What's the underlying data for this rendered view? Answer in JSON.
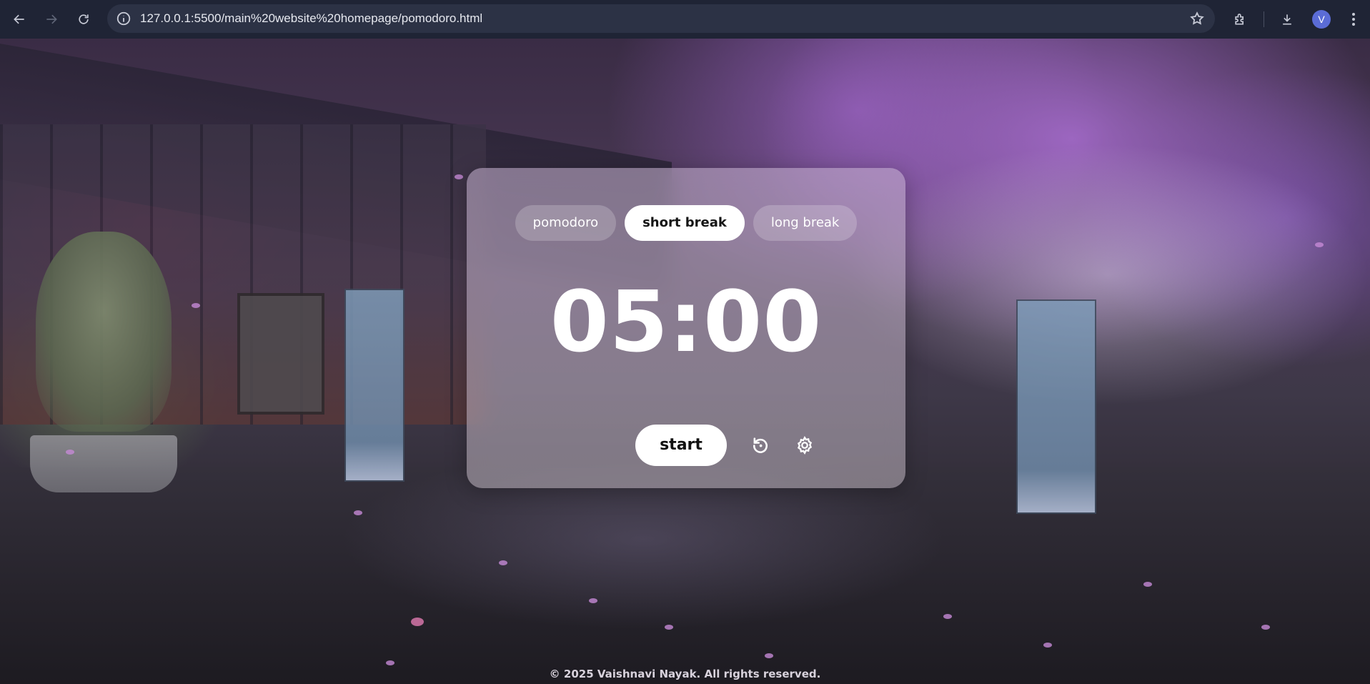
{
  "browser": {
    "url": "127.0.0.1:5500/main%20website%20homepage/pomodoro.html",
    "profile_initial": "V",
    "icons": {
      "back": "back-arrow-icon",
      "forward": "forward-arrow-icon",
      "reload": "reload-icon",
      "site_info": "info-icon",
      "bookmark": "star-icon",
      "extensions": "puzzle-icon",
      "downloads": "download-icon",
      "menu": "kebab-menu-icon"
    }
  },
  "timer": {
    "modes": [
      {
        "label": "pomodoro",
        "active": false
      },
      {
        "label": "short break",
        "active": true
      },
      {
        "label": "long break",
        "active": false
      }
    ],
    "time": "05:00",
    "start_label": "start",
    "icons": {
      "reset": "reset-icon",
      "settings": "gear-icon"
    }
  },
  "footer": {
    "copyright": "© 2025 Vaishnavi Nayak. All rights reserved."
  },
  "colors": {
    "chrome_bg": "#1f2435",
    "omnibox_bg": "#2c3245",
    "active_tab_bg": "#ffffff",
    "card_tint": "#c8b4d2"
  }
}
